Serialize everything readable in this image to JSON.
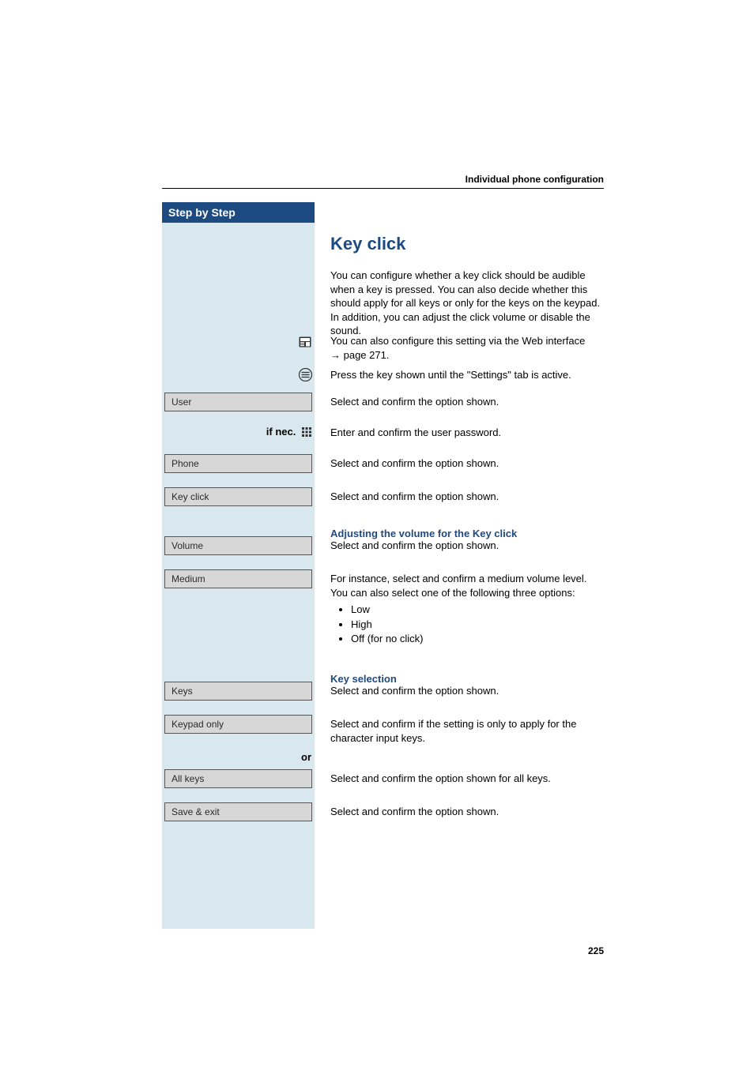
{
  "header": "Individual phone configuration",
  "sidebar_title": "Step by Step",
  "title": "Key click",
  "intro": "You can configure whether a key click should be audible when a key is pressed. You can also decide whether this should apply for all keys or only for the keys on the keypad. In addition, you can adjust the click volume or disable the sound.",
  "web_1": "You can also configure this setting via the Web interface ",
  "web_arrow": "→",
  "web_page": " page 271.",
  "press_key": "Press the key shown until the \"Settings\" tab is active.",
  "user": {
    "label": "User",
    "desc": "Select and confirm the option shown."
  },
  "ifnec": {
    "label": "if nec.",
    "desc": "Enter and confirm the user password."
  },
  "phone": {
    "label": "Phone",
    "desc": "Select and confirm the option shown."
  },
  "keyclick": {
    "label": "Key click",
    "desc": "Select and confirm the option shown."
  },
  "h_adjust": "Adjusting the volume for the Key click",
  "volume": {
    "label": "Volume",
    "desc": "Select and confirm the option shown."
  },
  "medium": {
    "label": "Medium",
    "desc": "For instance, select and confirm a medium volume level. You can also select one of the following three options:",
    "opts": [
      "Low",
      "High",
      "Off (for no click)"
    ]
  },
  "h_keysel": "Key selection",
  "keys": {
    "label": "Keys",
    "desc": "Select and confirm the option shown."
  },
  "keypad": {
    "label": "Keypad only",
    "desc": "Select and confirm if the setting is only to apply for the character input keys."
  },
  "or": "or",
  "allkeys": {
    "label": "All keys",
    "desc": "Select and confirm the option shown for all keys."
  },
  "saveexit": {
    "label": "Save & exit",
    "desc": "Select and confirm the option shown."
  },
  "page_num": "225"
}
